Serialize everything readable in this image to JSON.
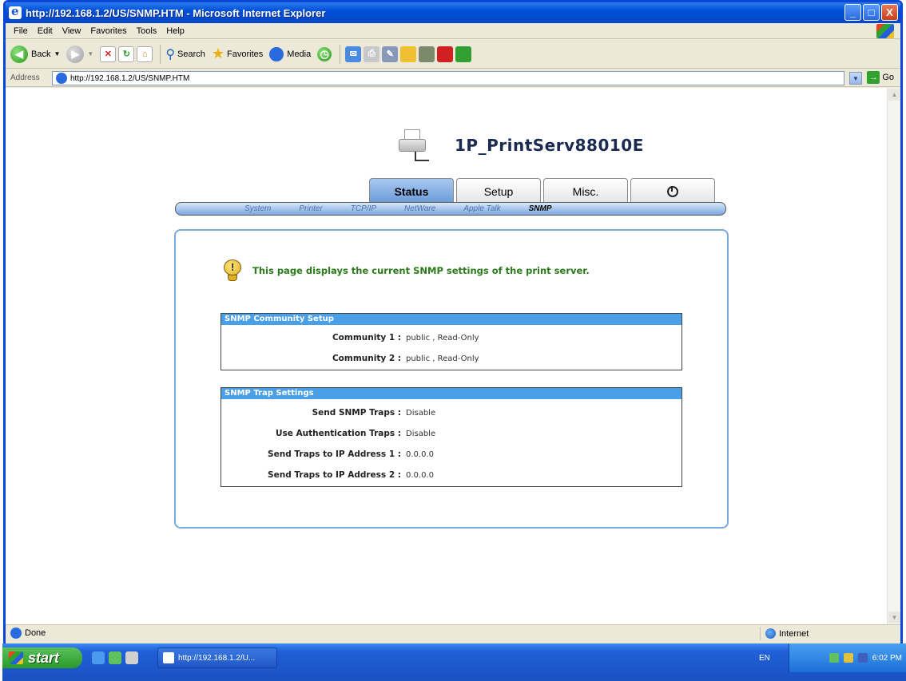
{
  "window": {
    "title": "http://192.168.1.2/US/SNMP.HTM - Microsoft Internet Explorer",
    "buttons": {
      "minimize": "_",
      "maximize": "□",
      "close": "X"
    }
  },
  "menu": [
    "File",
    "Edit",
    "View",
    "Favorites",
    "Tools",
    "Help"
  ],
  "toolbar": {
    "back": "Back",
    "search": "Search",
    "favorites": "Favorites",
    "media": "Media"
  },
  "address": {
    "label": "Address",
    "url": "http://192.168.1.2/US/SNMP.HTM",
    "go": "Go"
  },
  "page": {
    "device_name": "1P_PrintServ88010E",
    "tabs": [
      {
        "label": "Status",
        "active": true
      },
      {
        "label": "Setup",
        "active": false
      },
      {
        "label": "Misc.",
        "active": false
      },
      {
        "label": "",
        "icon": "power-icon",
        "active": false
      }
    ],
    "subnav": [
      {
        "label": "System",
        "active": false
      },
      {
        "label": "Printer",
        "active": false
      },
      {
        "label": "TCP/IP",
        "active": false
      },
      {
        "label": "NetWare",
        "active": false
      },
      {
        "label": "Apple Talk",
        "active": false
      },
      {
        "label": "SNMP",
        "active": true
      }
    ],
    "info_text": "This page displays the current SNMP settings of the print server.",
    "community": {
      "heading": "SNMP Community Setup",
      "rows": [
        {
          "label": "Community 1 :",
          "value": "public , Read-Only"
        },
        {
          "label": "Community 2 :",
          "value": "public , Read-Only"
        }
      ]
    },
    "trap": {
      "heading": "SNMP Trap Settings",
      "rows": [
        {
          "label": "Send SNMP Traps :",
          "value": "Disable"
        },
        {
          "label": "Use Authentication Traps :",
          "value": "Disable"
        },
        {
          "label": "Send Traps to IP Address 1 :",
          "value": "0.0.0.0"
        },
        {
          "label": "Send Traps to IP Address 2 :",
          "value": "0.0.0.0"
        }
      ]
    }
  },
  "status": {
    "text": "Done",
    "zone": "Internet"
  },
  "taskbar": {
    "start": "start",
    "task": "http://192.168.1.2/U...",
    "lang": "EN",
    "clock": "6:02 PM"
  },
  "colors": {
    "title_bar": "#0050d8",
    "info_text": "#2a7a1a",
    "box_header": "#4aa0e8",
    "panel_border": "#7aa8d8"
  }
}
